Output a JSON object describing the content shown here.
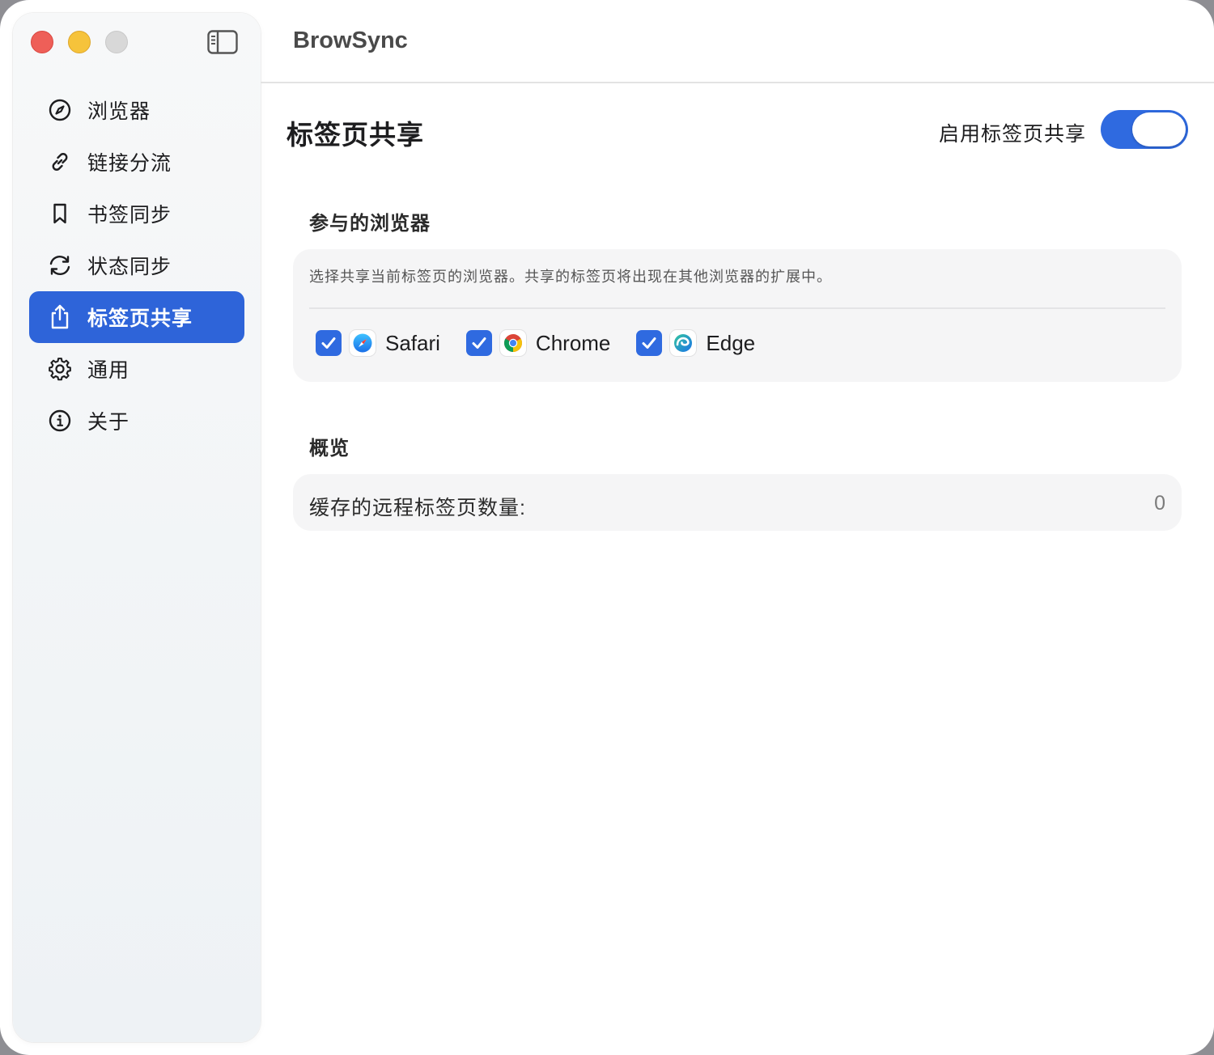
{
  "app": {
    "title": "BrowSync"
  },
  "sidebar": {
    "items": [
      {
        "label": "浏览器",
        "icon": "compass-icon",
        "active": false
      },
      {
        "label": "链接分流",
        "icon": "link-icon",
        "active": false
      },
      {
        "label": "书签同步",
        "icon": "bookmark-icon",
        "active": false
      },
      {
        "label": "状态同步",
        "icon": "sync-icon",
        "active": false
      },
      {
        "label": "标签页共享",
        "icon": "share-icon",
        "active": true
      },
      {
        "label": "通用",
        "icon": "gear-icon",
        "active": false
      },
      {
        "label": "关于",
        "icon": "info-icon",
        "active": false
      }
    ]
  },
  "page": {
    "title": "标签页共享",
    "enable_label": "启用标签页共享",
    "enabled": true
  },
  "browsers_section": {
    "heading": "参与的浏览器",
    "description": "选择共享当前标签页的浏览器。共享的标签页将出现在其他浏览器的扩展中。",
    "browsers": [
      {
        "name": "Safari",
        "checked": true,
        "icon": "safari-icon"
      },
      {
        "name": "Chrome",
        "checked": true,
        "icon": "chrome-icon"
      },
      {
        "name": "Edge",
        "checked": true,
        "icon": "edge-icon"
      }
    ]
  },
  "overview_section": {
    "heading": "概览",
    "cached_tabs_label": "缓存的远程标签页数量:",
    "cached_tabs_value": "0"
  },
  "colors": {
    "accent": "#2f6ae0",
    "sidebar_active": "#2e64d9",
    "close": "#ee5f58",
    "minimize": "#f6c33b"
  }
}
